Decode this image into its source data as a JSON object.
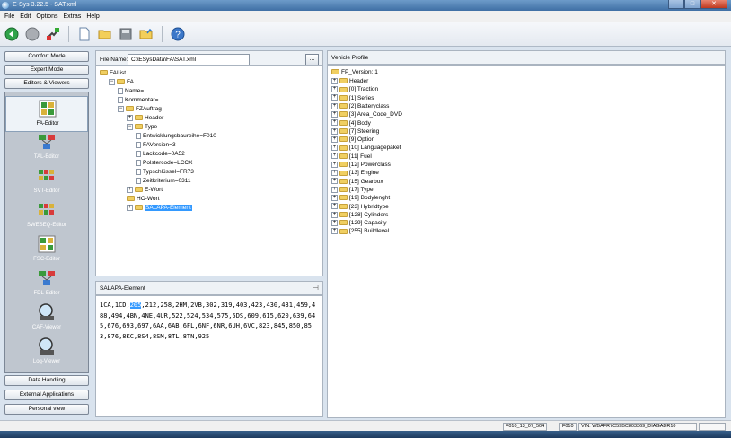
{
  "window": {
    "title": "E-Sys 3.22.5 - SAT.xml",
    "min": "–",
    "max": "□",
    "close": "✕"
  },
  "menu": [
    "File",
    "Edit",
    "Options",
    "Extras",
    "Help"
  ],
  "toolbar": {
    "icons": [
      "back-icon",
      "stop-icon",
      "connect-icon",
      "new-file-icon",
      "open-folder-icon",
      "save-icon",
      "open-file-icon",
      "help-icon"
    ]
  },
  "modes": {
    "comfort": "Comfort Mode",
    "expert": "Expert Mode",
    "editors": "Editors & Viewers"
  },
  "editors": [
    {
      "name": "FA-Editor",
      "selected": true
    },
    {
      "name": "TAL-Editor",
      "selected": false
    },
    {
      "name": "SVT-Editor",
      "selected": false
    },
    {
      "name": "SWESEQ-Editor",
      "selected": false
    },
    {
      "name": "FSC-Editor",
      "selected": false
    },
    {
      "name": "FDL-Editor",
      "selected": false
    },
    {
      "name": "CAF-Viewer",
      "selected": false
    },
    {
      "name": "Log-Viewer",
      "selected": false
    }
  ],
  "bottom_buttons": {
    "data": "Data Handling",
    "external": "External Applications",
    "personal": "Personal view"
  },
  "file": {
    "label": "File Name:",
    "value": "C:\\ESysData\\FA\\SAT.xml",
    "browse": "..."
  },
  "fa_tree": [
    {
      "label": "FAList",
      "level": 0,
      "kind": "folder",
      "exp": ""
    },
    {
      "label": "FA",
      "level": 1,
      "kind": "folder",
      "exp": "−"
    },
    {
      "label": "Name=",
      "level": 2,
      "kind": "leaf",
      "exp": ""
    },
    {
      "label": "Kommentar=",
      "level": 2,
      "kind": "leaf",
      "exp": ""
    },
    {
      "label": "FZAuftrag",
      "level": 2,
      "kind": "folder",
      "exp": "−"
    },
    {
      "label": "Header",
      "level": 3,
      "kind": "folder",
      "exp": "+"
    },
    {
      "label": "Type",
      "level": 3,
      "kind": "folder",
      "exp": "−"
    },
    {
      "label": "Entwicklungsbaureihe=F010",
      "level": 4,
      "kind": "leaf",
      "exp": ""
    },
    {
      "label": "FAVersion=3",
      "level": 4,
      "kind": "leaf",
      "exp": ""
    },
    {
      "label": "Lackcode=0A52",
      "level": 4,
      "kind": "leaf",
      "exp": ""
    },
    {
      "label": "Polstercode=LCCX",
      "level": 4,
      "kind": "leaf",
      "exp": ""
    },
    {
      "label": "Typschlüssel=FR73",
      "level": 4,
      "kind": "leaf",
      "exp": ""
    },
    {
      "label": "Zeitkriterium=0311",
      "level": 4,
      "kind": "leaf",
      "exp": ""
    },
    {
      "label": "E-Wort",
      "level": 3,
      "kind": "folder",
      "exp": "+"
    },
    {
      "label": "HO-Wort",
      "level": 3,
      "kind": "folder",
      "exp": ""
    },
    {
      "label": "SALAPA-Element",
      "level": 3,
      "kind": "folder",
      "exp": "+",
      "selected": true
    }
  ],
  "salapa": {
    "title": "SALAPA-Element",
    "pre": "1CA,1CD,",
    "selected": "205",
    "post": ",212,258,2HM,2VB,302,319,403,423,430,431,459,488,494,4BN,4NE,4UR,522,524,534,575,5DS,609,615,620,639,645,676,693,697,6AA,6AB,6FL,6NF,6NR,6UH,6VC,823,845,850,853,876,8KC,8S4,8SM,8TL,8TN,925"
  },
  "vehicle_profile": {
    "title": "Vehicle Profile",
    "root": "FP_Version: 1",
    "items": [
      "Header",
      "[0] Traction",
      "[1] Series",
      "[2] Batteryclass",
      "[3] Area_Code_DVD",
      "[4] Body",
      "[7] Steering",
      "[9] Option",
      "[10] Languagepaket",
      "[11] Fuel",
      "[12] Powerclass",
      "[13] Engine",
      "[15] Gearbox",
      "[17] Type",
      "[19] Bodylenght",
      "[23] Hybridtype",
      "[128] Cylinders",
      "[129] Capacity",
      "[255] Buildlevel"
    ]
  },
  "status": {
    "i_step": "F010_13_07_504",
    "series": "F010",
    "vin": "VIN: WBAFR7C59BC803369_DIAGADR10"
  },
  "colors": {
    "selection": "#3399ff",
    "folder": "#f0cf62",
    "panel": "#d9e3ee"
  }
}
